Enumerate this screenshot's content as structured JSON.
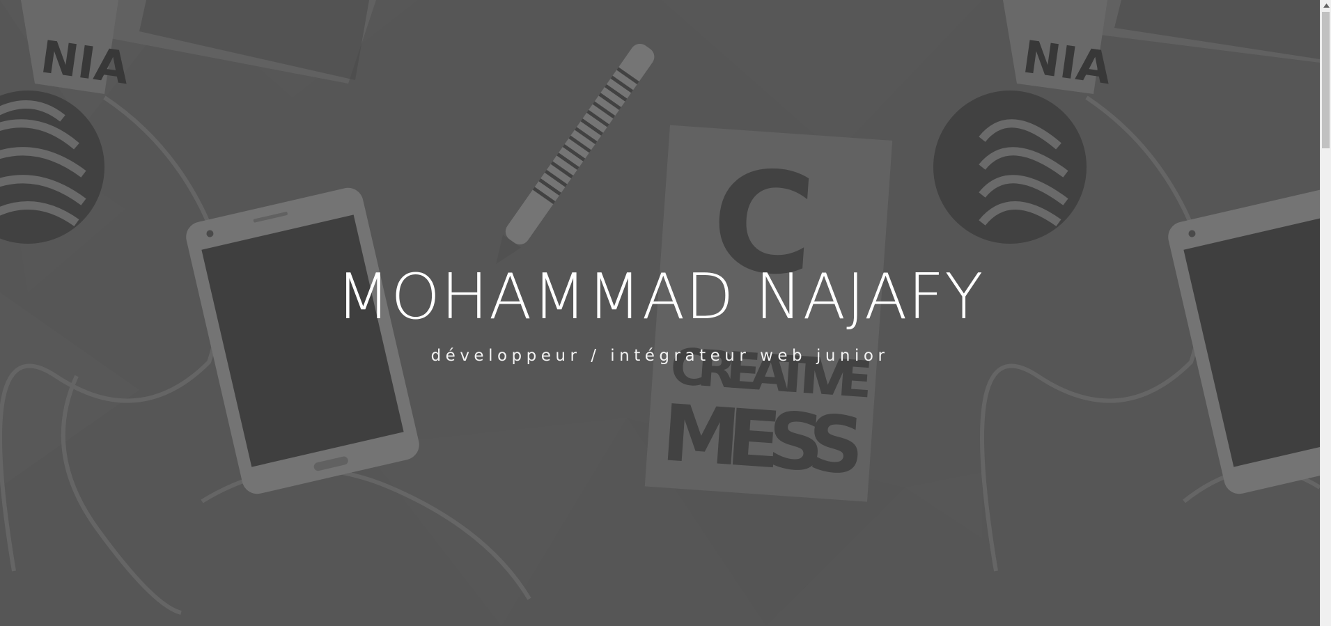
{
  "hero": {
    "title": "MOHAMMAD NAJAFY",
    "subtitle": "développeur / intégrateur web junior"
  },
  "background": {
    "description_image_text": [
      "NIA",
      "C",
      "CREATIVE",
      "MESS"
    ],
    "overlay_color": "#5a5a5a"
  },
  "scrollbar": {
    "up_icon": "chevron-up-icon",
    "thumb_position": 0
  }
}
